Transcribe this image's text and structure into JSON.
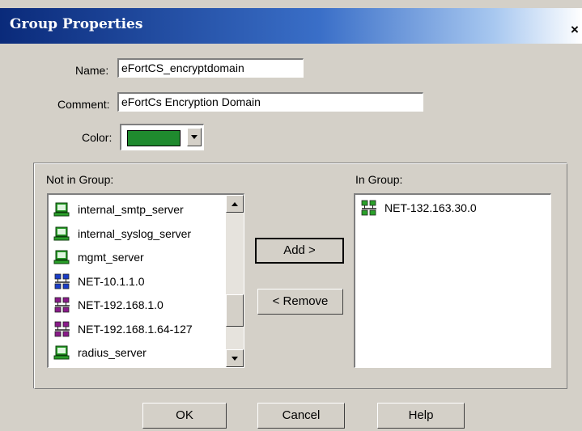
{
  "window": {
    "title": "Group Properties",
    "close_label": "×"
  },
  "form": {
    "name_label": "Name:",
    "name_value": "eFortCS_encryptdomain",
    "comment_label": "Comment:",
    "comment_value": "eFortCs Encryption Domain",
    "color_label": "Color:",
    "color_value": "#1f8a2e"
  },
  "not_in_group": {
    "label": "Not in Group:",
    "items": [
      {
        "label": "internal_smtp_server",
        "icon": "server-icon",
        "color": "#2aa02a"
      },
      {
        "label": "internal_syslog_server",
        "icon": "server-icon",
        "color": "#2aa02a"
      },
      {
        "label": "mgmt_server",
        "icon": "server-icon",
        "color": "#2aa02a"
      },
      {
        "label": "NET-10.1.1.0",
        "icon": "network-icon",
        "color": "#1a3cc8"
      },
      {
        "label": "NET-192.168.1.0",
        "icon": "network-icon",
        "color": "#8a1a8a"
      },
      {
        "label": "NET-192.168.1.64-127",
        "icon": "network-icon",
        "color": "#8a1a8a"
      },
      {
        "label": "radius_server",
        "icon": "server-icon",
        "color": "#2aa02a"
      }
    ]
  },
  "in_group": {
    "label": "In Group:",
    "items": [
      {
        "label": "NET-132.163.30.0",
        "icon": "network-icon",
        "color": "#2aa02a"
      }
    ]
  },
  "buttons": {
    "add": "Add  >",
    "remove": "<  Remove",
    "ok": "OK",
    "cancel": "Cancel",
    "help": "Help"
  }
}
